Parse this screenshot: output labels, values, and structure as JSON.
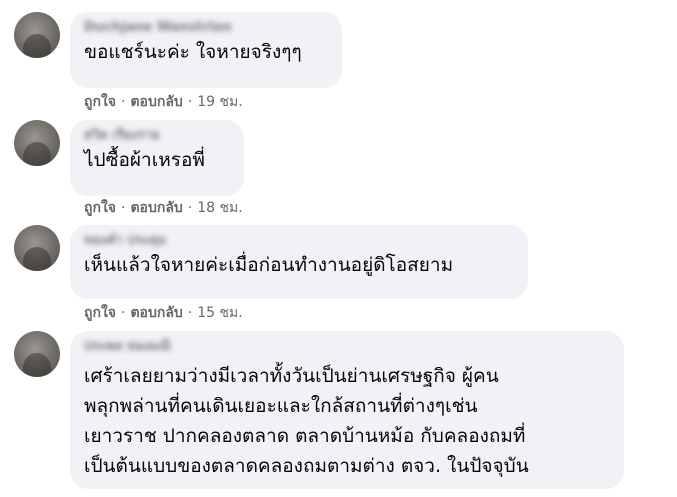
{
  "comments": [
    {
      "author": "Duchjane Wanstrlan",
      "text": "ขอแชร์นะค่ะ ใจหายจริงๆๆ",
      "like_label": "ถูกใจ",
      "reply_label": "ตอบกลับ",
      "time": "19 ชม."
    },
    {
      "author": "สวิต เรียงราย",
      "text": "ไปซื้อผ้าเหรอพี่",
      "like_label": "ถูกใจ",
      "reply_label": "ตอบกลับ",
      "time": "18 ชม."
    },
    {
      "author": "ทองคำ ประดุม",
      "text": "เห็นแล้วใจหายค่ะเมื่อก่อนทำงานอยู่ดิโอสยาม",
      "like_label": "ถูกใจ",
      "reply_label": "ตอบกลับ",
      "time": "15 ชม."
    },
    {
      "author": "ประพล ทองมณี",
      "text": "เศร้าเลยยามว่างมีเวลาทั้งวันเป็นย่านเศรษฐกิจ ผู้คน\nพลุกพล่านที่คนเดินเยอะและใกล้สถานที่ต่างๆเช่น\nเยาวราช ปากคลองตลาด ตลาดบ้านหม้อ กับคลองถมที่\nเป็นต้นแบบของตลาดคลองถมตามต่าง ตจว. ในปัจจุบัน"
    }
  ]
}
